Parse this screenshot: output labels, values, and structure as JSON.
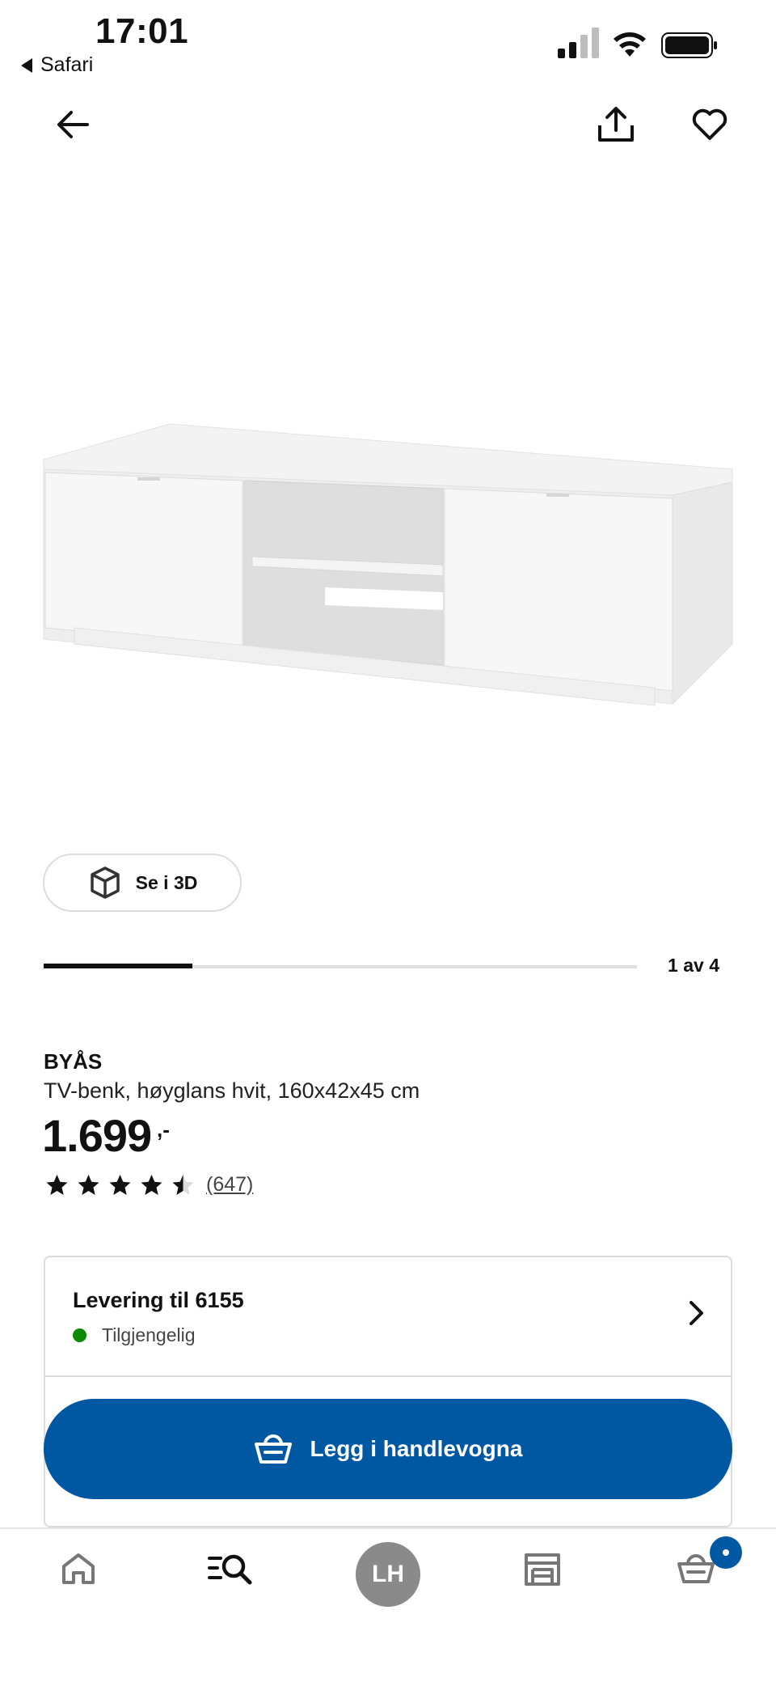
{
  "status_bar": {
    "time": "17:01",
    "back_app_label": "Safari",
    "icons": [
      "cellular-signal-icon",
      "wifi-icon",
      "battery-icon"
    ]
  },
  "top_nav": {
    "icons": [
      "arrow-left-icon",
      "share-icon",
      "heart-icon"
    ]
  },
  "gallery": {
    "view_3d_label": "Se i 3D",
    "view_3d_icon": "cube-icon",
    "pager_text": "1 av 4",
    "current": 1,
    "total": 4
  },
  "product": {
    "name": "BYÅS",
    "description": "TV-benk, høyglans hvit, 160x42x45 cm",
    "price": "1.699",
    "price_suffix": ",-",
    "rating": 4.5,
    "rating_max": 5,
    "review_count": "(647)"
  },
  "delivery": {
    "title": "Levering til 6155",
    "status": "Tilgjengelig",
    "status_color": "#0a8a00"
  },
  "cart": {
    "button_label": "Legg i handlevogna",
    "button_icon": "shopping-basket-icon",
    "color": "#0058a3"
  },
  "tab_bar": {
    "icons": [
      "home-icon",
      "search-list-icon",
      "profile-avatar",
      "store-icon",
      "basket-icon"
    ],
    "avatar_initials": "LH",
    "cart_badge_color": "#0058a3"
  }
}
